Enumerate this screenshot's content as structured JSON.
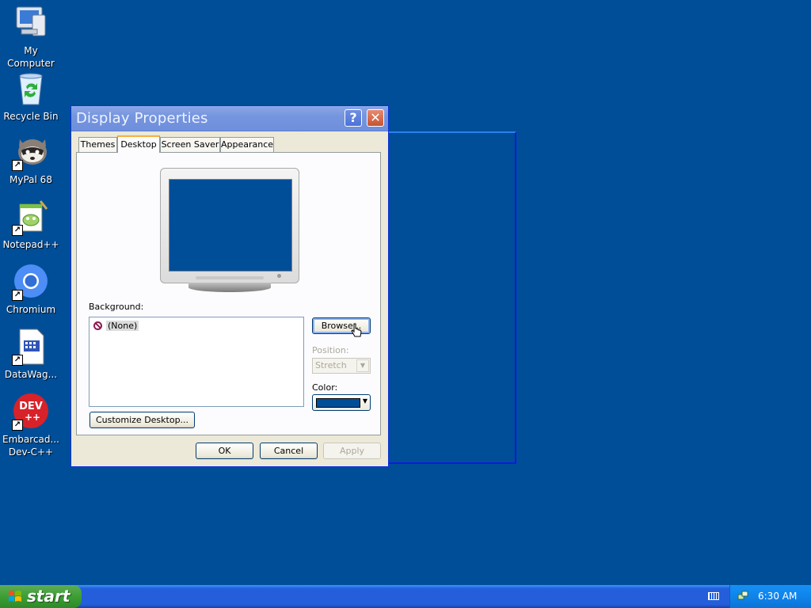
{
  "desktop": {
    "icons": [
      {
        "label_1": "My",
        "label_2": "Computer"
      },
      {
        "label_1": "Recycle Bin"
      },
      {
        "label_1": "MyPal 68"
      },
      {
        "label_1": "Notepad++"
      },
      {
        "label_1": "Chromium"
      },
      {
        "label_1": "DataWag..."
      },
      {
        "label_1": "Embarcad...",
        "label_2": "Dev-C++"
      }
    ]
  },
  "dialog": {
    "title": "Display Properties",
    "help_label": "?",
    "close_label": "✕",
    "tabs": [
      "Themes",
      "Desktop",
      "Screen Saver",
      "Appearance"
    ],
    "active_tab": "Desktop",
    "background_label": "Background:",
    "background_items": [
      "(None)"
    ],
    "browse_label": "Browse...",
    "position_label": "Position:",
    "position_value": "Stretch",
    "color_label": "Color:",
    "color_value": "#004e98",
    "customize_label": "Customize Desktop...",
    "ok_label": "OK",
    "cancel_label": "Cancel",
    "apply_label": "Apply"
  },
  "taskbar": {
    "start_label": "start",
    "clock": "6:30 AM"
  },
  "colors": {
    "desktop_bg": "#004e98",
    "title_bar": "#7595df",
    "taskbar": "#245edb",
    "start_button": "#3c9e35"
  }
}
